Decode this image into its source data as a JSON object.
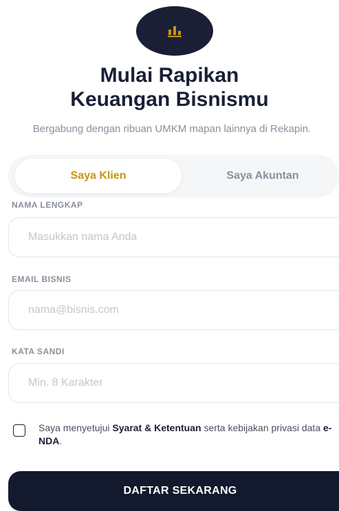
{
  "colors": {
    "navy": "#1a1f36",
    "accent_gold": "#c7940f",
    "muted_text": "#8a8f9c"
  },
  "logo": {
    "icon": "bar-chart-icon"
  },
  "title": {
    "line1": "Mulai Rapikan",
    "line2": "Keuangan Bisnismu"
  },
  "subtitle": "Bergabung dengan ribuan UMKM mapan lainnya di Rekapin.",
  "tabs": [
    {
      "label": "Saya Klien",
      "active": true
    },
    {
      "label": "Saya Akuntan",
      "active": false
    }
  ],
  "form": {
    "name": {
      "label": "NAMA LENGKAP",
      "placeholder": "Masukkan nama Anda",
      "value": ""
    },
    "email": {
      "label": "EMAIL BISNIS",
      "placeholder": "nama@bisnis.com",
      "value": ""
    },
    "password": {
      "label": "KATA SANDI",
      "placeholder": "Min. 8 Karakter",
      "value": ""
    }
  },
  "consent": {
    "checked": false,
    "prefix": "Saya menyetujui ",
    "terms": "Syarat & Ketentuan",
    "middle": " serta kebijakan privasi data ",
    "nda": "e-NDA",
    "suffix": "."
  },
  "submit_label": "DAFTAR SEKARANG"
}
